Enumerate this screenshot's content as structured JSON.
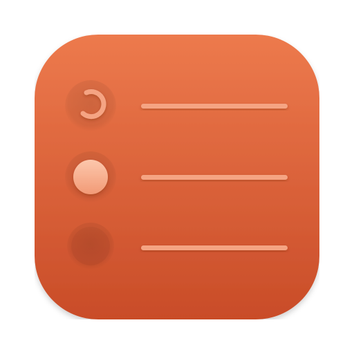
{
  "app_icon": {
    "icon": "task-list-icon",
    "colors": {
      "tile_top": "#ED7A4D",
      "tile_bottom": "#C94C28",
      "accent": "#F5A483",
      "accent_light": "#FBC3A7"
    },
    "rows": [
      {
        "icon": "progress-ring-icon",
        "state": "in-progress"
      },
      {
        "icon": "filled-circle-icon",
        "state": "active"
      },
      {
        "icon": "empty-circle-icon",
        "state": "pending"
      }
    ]
  }
}
